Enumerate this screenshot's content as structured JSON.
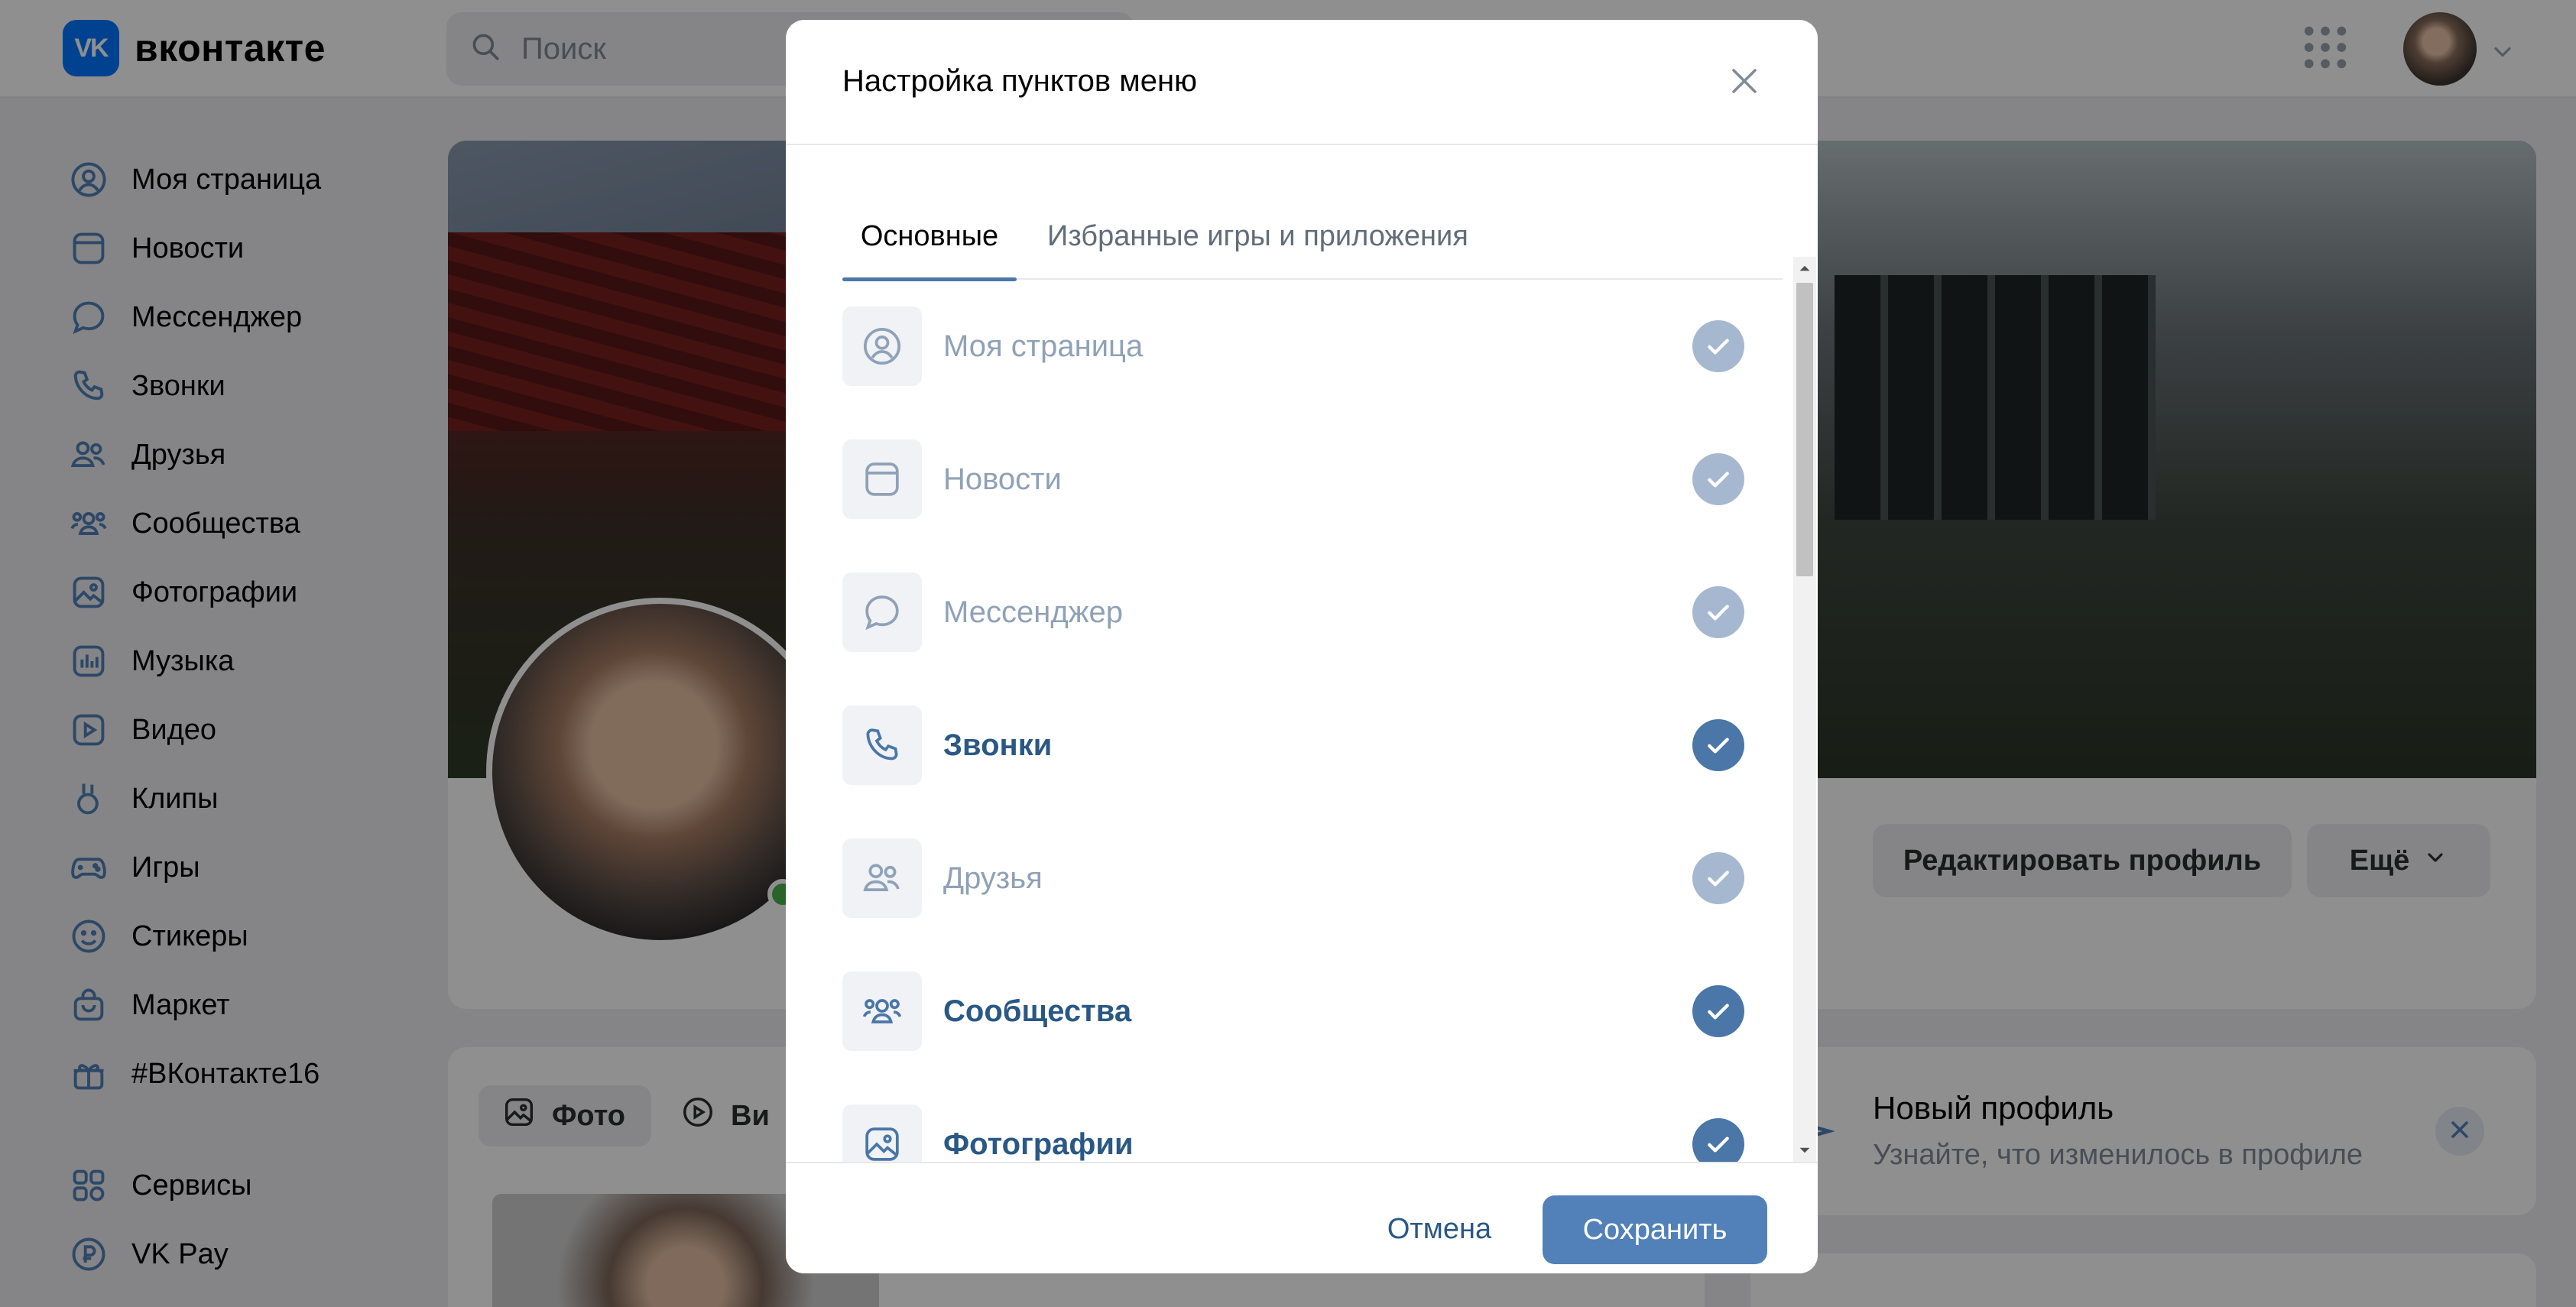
{
  "header": {
    "logo_mark": "VK",
    "logo_text": "вконтакте",
    "search_placeholder": "Поиск"
  },
  "sidebar": {
    "items": [
      {
        "label": "Моя страница",
        "icon": "user-circle-icon"
      },
      {
        "label": "Новости",
        "icon": "newsfeed-icon"
      },
      {
        "label": "Мессенджер",
        "icon": "message-icon"
      },
      {
        "label": "Звонки",
        "icon": "phone-icon"
      },
      {
        "label": "Друзья",
        "icon": "friends-icon"
      },
      {
        "label": "Сообщества",
        "icon": "communities-icon"
      },
      {
        "label": "Фотографии",
        "icon": "photo-icon"
      },
      {
        "label": "Музыка",
        "icon": "music-icon"
      },
      {
        "label": "Видео",
        "icon": "video-icon"
      },
      {
        "label": "Клипы",
        "icon": "clips-icon"
      },
      {
        "label": "Игры",
        "icon": "gamepad-icon"
      },
      {
        "label": "Стикеры",
        "icon": "smile-icon"
      },
      {
        "label": "Маркет",
        "icon": "bag-icon"
      },
      {
        "label": "#ВКонтакте16",
        "icon": "gift-icon"
      },
      {
        "label": "Сервисы",
        "icon": "services-icon"
      },
      {
        "label": "VK Pay",
        "icon": "vkpay-icon"
      }
    ]
  },
  "profile": {
    "edit_button": "Редактировать профиль",
    "more_button": "Ещё",
    "tab_photo": "Фото",
    "tab_video": "Ви"
  },
  "new_profile": {
    "title": "Новый профиль",
    "subtitle": "Узнайте, что изменилось в профиле"
  },
  "modal": {
    "title": "Настройка пунктов меню",
    "tabs": [
      {
        "label": "Основные",
        "active": true
      },
      {
        "label": "Избранные игры и приложения",
        "active": false
      }
    ],
    "items": [
      {
        "label": "Моя страница",
        "checked": true,
        "locked": true
      },
      {
        "label": "Новости",
        "checked": true,
        "locked": true
      },
      {
        "label": "Мессенджер",
        "checked": true,
        "locked": true
      },
      {
        "label": "Звонки",
        "checked": true,
        "locked": false
      },
      {
        "label": "Друзья",
        "checked": true,
        "locked": true
      },
      {
        "label": "Сообщества",
        "checked": true,
        "locked": false
      },
      {
        "label": "Фотографии",
        "checked": true,
        "locked": false
      }
    ],
    "cancel_button": "Отмена",
    "save_button": "Сохранить"
  },
  "colors": {
    "accent": "#4a76a8",
    "save_button": "#5181b8",
    "locked_check": "#a6b8cf",
    "link": "#2a5885",
    "online": "#4bb34b"
  }
}
